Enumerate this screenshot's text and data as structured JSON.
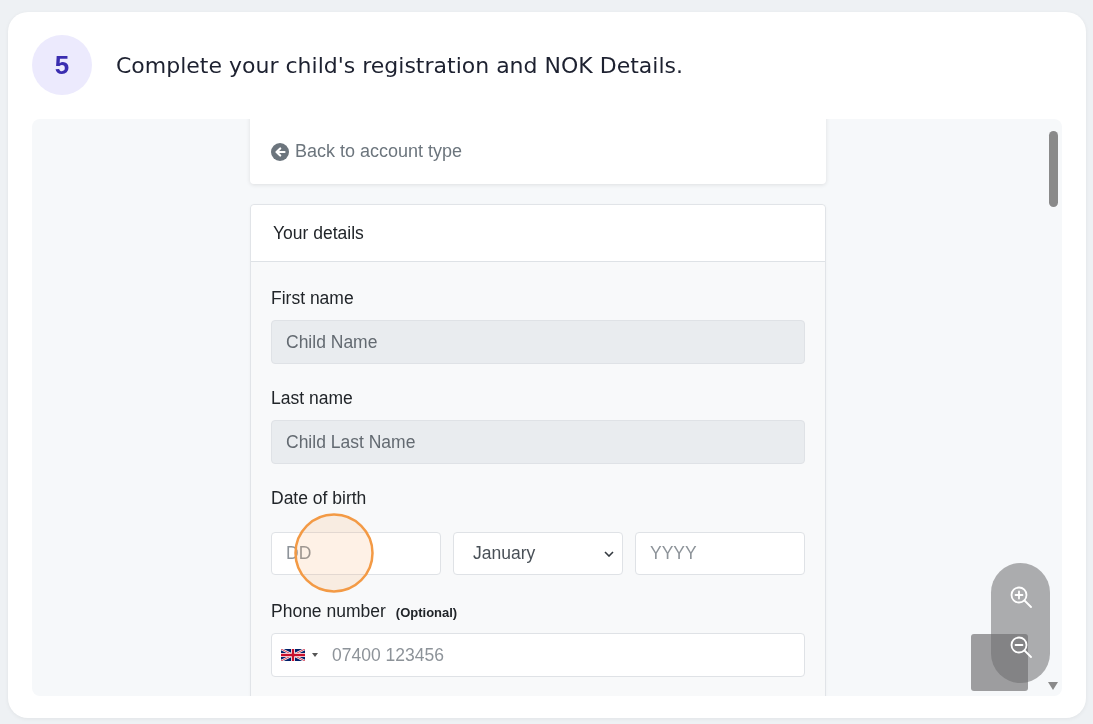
{
  "step": {
    "number": "5",
    "title": "Complete your child's registration and NOK Details."
  },
  "screenshot": {
    "back_link": {
      "label": "Back to account type"
    },
    "details_card": {
      "title": "Your details",
      "fields": [
        {
          "kind": "text",
          "label": "First name",
          "placeholder": "Child Name",
          "disabled": true
        },
        {
          "kind": "text",
          "label": "Last name",
          "placeholder": "Child Last Name",
          "disabled": true
        },
        {
          "kind": "date",
          "label": "Date of birth",
          "day_placeholder": "DD",
          "month_value": "January",
          "year_placeholder": "YYYY",
          "disabled": false
        },
        {
          "kind": "phone",
          "label": "Phone number",
          "note": "(Optional)",
          "placeholder": "07400 123456",
          "disabled": false
        }
      ]
    }
  }
}
